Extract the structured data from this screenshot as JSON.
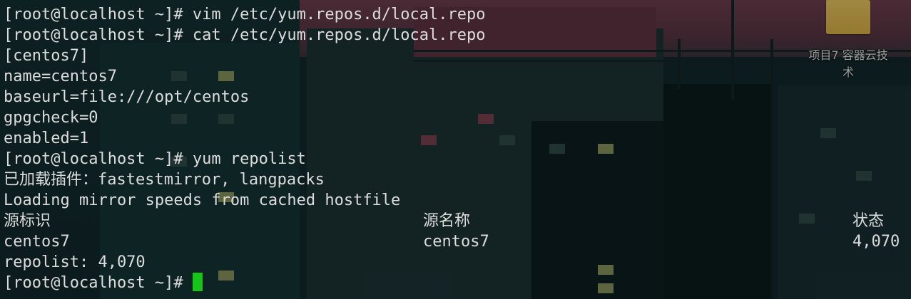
{
  "desktop": {
    "icon": {
      "name": "folder-icon",
      "label": "项目7 容器云技术"
    }
  },
  "terminal": {
    "lines": [
      "[root@localhost ~]# vim /etc/yum.repos.d/local.repo",
      "[root@localhost ~]# cat /etc/yum.repos.d/local.repo",
      "[centos7]",
      "name=centos7",
      "baseurl=file:///opt/centos",
      "gpgcheck=0",
      "enabled=1",
      "[root@localhost ~]# yum repolist",
      "已加载插件：fastestmirror, langpacks",
      "Loading mirror speeds from cached hostfile"
    ],
    "table": {
      "headers": [
        "源标识",
        "源名称",
        "状态"
      ],
      "rows": [
        [
          "centos7",
          "centos7",
          "4,070"
        ]
      ]
    },
    "summary": "repolist: 4,070",
    "prompt": "[root@localhost ~]# ",
    "cursor_color": "#17c41a",
    "text_color": "#dcdcdc"
  }
}
